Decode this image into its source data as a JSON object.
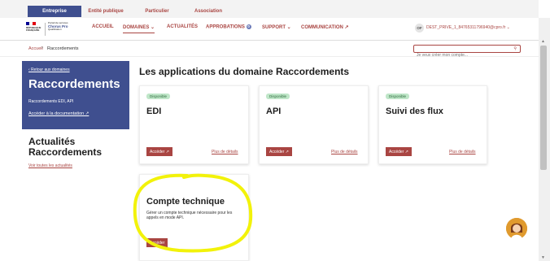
{
  "audience_tabs": [
    {
      "label": "Entreprise",
      "active": true
    },
    {
      "label": "Entité publique",
      "active": false
    },
    {
      "label": "Particulier",
      "active": false
    },
    {
      "label": "Association",
      "active": false
    }
  ],
  "logo": {
    "rf_lines": [
      "RÉPUBLIQUE",
      "FRANÇAISE"
    ],
    "brand_small": "Portail de services",
    "brand_name": "Chorus Pro",
    "brand_sub": "Qualification"
  },
  "nav": {
    "accueil": "ACCUEIL",
    "domaines": "DOMAINES ⌄",
    "actualites": "ACTUALITÉS",
    "approbations": "APPROBATIONS",
    "approbations_count": "0",
    "support": "SUPPORT ⌄",
    "communication": "COMMUNICATION ↗"
  },
  "user": {
    "initials": "OF",
    "id": "DEST_PRIVE_1_84765311796940@cpro.fr ⌄"
  },
  "breadcrumb": {
    "home": "Accueil",
    "current": "Raccordements"
  },
  "search": {
    "placeholder": "Je veux créer mon compte..."
  },
  "sidebar": {
    "back": "‹ Retour aux domaines",
    "title": "Raccordements",
    "subtitle": "Raccordements EDI, API",
    "doc_link": "Accéder à la documentation ↗"
  },
  "news": {
    "title_line1": "Actualités",
    "title_line2": "Raccordements",
    "link": "Voir toutes les actualités"
  },
  "main": {
    "title": "Les applications du domaine Raccordements"
  },
  "cards": [
    {
      "status": "Disponible",
      "title": "EDI",
      "action": "Accéder ↗",
      "more": "Plus de détails"
    },
    {
      "status": "Disponible",
      "title": "API",
      "action": "Accéder ↗",
      "more": "Plus de détails"
    },
    {
      "status": "Disponible",
      "title": "Suivi des flux",
      "action": "Accéder ↗",
      "more": "Plus de détails"
    },
    {
      "title": "Compte technique",
      "description": "Gérer un compte technique nécessaire pour les appels en mode API.",
      "action": "Accéder"
    }
  ],
  "colors": {
    "brand_blue": "#3f4f8f",
    "accent_red": "#a94542",
    "status_green": "#bfe6c8",
    "highlight_yellow": "#f2f20a"
  }
}
